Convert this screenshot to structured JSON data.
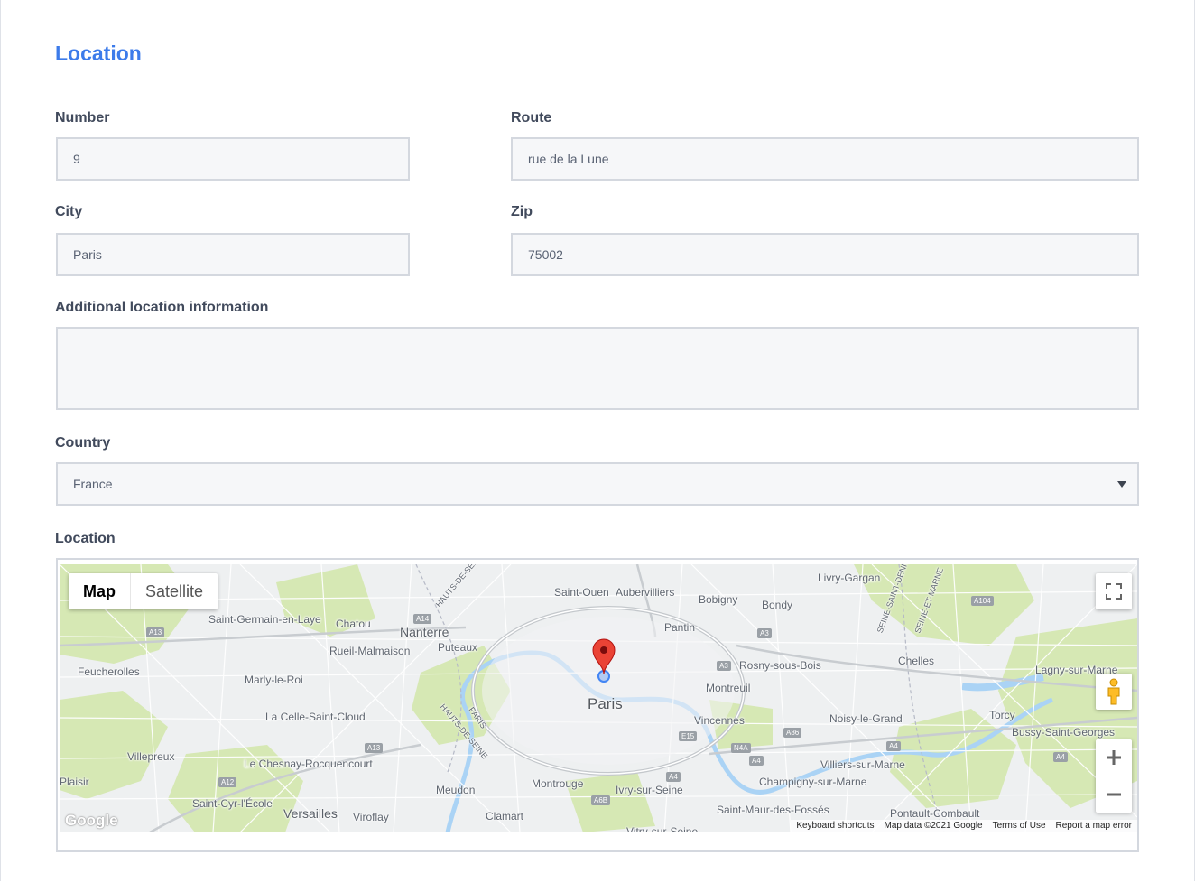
{
  "section": {
    "title": "Location"
  },
  "fields": {
    "number": {
      "label": "Number",
      "value": "9"
    },
    "route": {
      "label": "Route",
      "value": "rue de la Lune"
    },
    "city": {
      "label": "City",
      "value": "Paris"
    },
    "zip": {
      "label": "Zip",
      "value": "75002"
    },
    "additional": {
      "label": "Additional location information",
      "value": ""
    },
    "country": {
      "label": "Country",
      "value": "France"
    }
  },
  "map": {
    "label": "Location",
    "type_controls": {
      "map": "Map",
      "satellite": "Satellite",
      "active": "Map"
    },
    "icons": {
      "fullscreen": "fullscreen-icon",
      "pegman": "pegman-icon",
      "zoom_in": "plus-icon",
      "zoom_out": "minus-icon",
      "marker": "map-pin-icon"
    },
    "colors": {
      "marker": "#ea4335",
      "location_dot": "#4285f4",
      "park": "#d6e8b4",
      "water": "#aad3f5"
    },
    "places": {
      "paris": "Paris",
      "saint_ouen": "Saint-Ouen",
      "aubervilliers": "Aubervilliers",
      "bobigny": "Bobigny",
      "bondy": "Bondy",
      "livry_gargan": "Livry-Gargan",
      "pantin": "Pantin",
      "nanterre": "Nanterre",
      "puteaux": "Puteaux",
      "chatou": "Chatou",
      "saint_germain": "Saint-Germain-en-Laye",
      "rueil": "Rueil-Malmaison",
      "feucherolles": "Feucherolles",
      "marly": "Marly-le-Roi",
      "la_celle": "La Celle-Saint-Cloud",
      "villepreux": "Villepreux",
      "le_chesnay": "Le Chesnay-Rocquencourt",
      "plaisir": "Plaisir",
      "saint_cyr": "Saint-Cyr-l'École",
      "versailles": "Versailles",
      "viroflay": "Viroflay",
      "meudon": "Meudon",
      "clamart": "Clamart",
      "montrouge": "Montrouge",
      "ivry": "Ivry-sur-Seine",
      "vitry": "Vitry-sur-Seine",
      "montreuil": "Montreuil",
      "rosny": "Rosny-sous-Bois",
      "vincennes": "Vincennes",
      "noisy": "Noisy-le-Grand",
      "chelles": "Chelles",
      "lagny": "Lagny-sur-Marne",
      "torcy": "Torcy",
      "bussy": "Bussy-Saint-Georges",
      "villiers": "Villiers-sur-Marne",
      "champigny": "Champigny-sur-Marne",
      "saint_maur": "Saint-Maur-des-Fossés",
      "pontault": "Pontault-Combault",
      "hauts_de_seine_1": "HAUTS-DE-SEINE",
      "hauts_de_seine_2": "HAUTS-DE-SEINE",
      "paris_dept": "PARIS",
      "seine_saint_denis": "SEINE-SAINT-DENIS",
      "seine_et_marne": "SEINE-ET-MARNE"
    },
    "roads": [
      "A14",
      "A13",
      "A13",
      "A12",
      "A3",
      "A3",
      "A86",
      "A4",
      "A4",
      "N4A",
      "A4",
      "A104",
      "E15",
      "A6B",
      "A4"
    ],
    "attribution": {
      "keyboard": "Keyboard shortcuts",
      "data": "Map data ©2021 Google",
      "terms": "Terms of Use",
      "report": "Report a map error"
    },
    "logo": "Google"
  }
}
